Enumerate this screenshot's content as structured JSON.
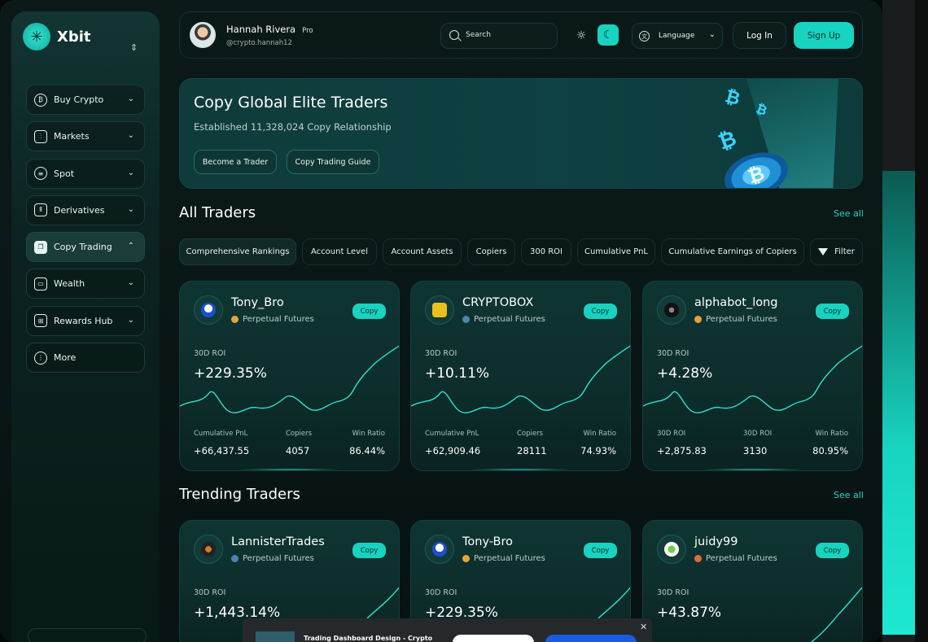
{
  "app": {
    "name": "Xbit"
  },
  "sidebar": {
    "items": [
      {
        "label": "Buy Crypto",
        "icon": "bitcoin-icon",
        "chevron": "⌄"
      },
      {
        "label": "Markets",
        "icon": "candles-icon",
        "chevron": "⌄"
      },
      {
        "label": "Spot",
        "icon": "spot-icon",
        "chevron": "⌄"
      },
      {
        "label": "Derivatives",
        "icon": "derivatives-icon",
        "chevron": "⌄"
      },
      {
        "label": "Copy Trading",
        "icon": "copy-icon",
        "chevron": "⌃",
        "active": true
      },
      {
        "label": "Wealth",
        "icon": "wallet-icon",
        "chevron": "⌄"
      },
      {
        "label": "Rewards Hub",
        "icon": "gift-icon",
        "chevron": "⌄"
      },
      {
        "label": "More",
        "icon": "more-icon",
        "chevron": ""
      }
    ]
  },
  "header": {
    "user_name": "Hannah Rivera",
    "user_tier": "Pro",
    "user_handle": "@crypto.hannah12",
    "search_placeholder": "Search",
    "language_label": "Language",
    "login_label": "Log In",
    "signup_label": "Sign Up"
  },
  "banner": {
    "title": "Copy Global Elite Traders",
    "subtitle": "Established 11,328,024 Copy Relationship",
    "btn_trader": "Become a Trader",
    "btn_guide": "Copy Trading Guide"
  },
  "all_traders": {
    "title": "All Traders",
    "see_all": "See all",
    "tabs": [
      "Comprehensive Rankings",
      "Account Level",
      "Account Assets",
      "Copiers",
      "300 ROI",
      "Cumulative PnL",
      "Cumulative Earnings of Copiers"
    ],
    "filter_label": "Filter",
    "cards": [
      {
        "name": "Tony_Bro",
        "market": "Perpetual Futures",
        "copy": "Copy",
        "roi_label": "30D ROI",
        "roi": "+229.35%",
        "stats": [
          {
            "label": "Cumulative PnL",
            "value": "+66,437.55"
          },
          {
            "label": "Copiers",
            "value": "4057"
          },
          {
            "label": "Win Ratio",
            "value": "86.44%"
          }
        ]
      },
      {
        "name": "CRYPTOBOX",
        "market": "Perpetual Futures",
        "copy": "Copy",
        "roi_label": "30D ROI",
        "roi": "+10.11%",
        "stats": [
          {
            "label": "Cumulative PnL",
            "value": "+62,909.46"
          },
          {
            "label": "Copiers",
            "value": "28111"
          },
          {
            "label": "Win Ratio",
            "value": "74.93%"
          }
        ]
      },
      {
        "name": "alphabot_long",
        "market": "Perpetual Futures",
        "copy": "Copy",
        "roi_label": "30D ROI",
        "roi": "+4.28%",
        "stats": [
          {
            "label": "30D ROI",
            "value": "+2,875.83"
          },
          {
            "label": "30D ROI",
            "value": "3130"
          },
          {
            "label": "Win Ratio",
            "value": "80.95%"
          }
        ]
      }
    ]
  },
  "trending": {
    "title": "Trending Traders",
    "see_all": "See all",
    "cards": [
      {
        "name": "LannisterTrades",
        "market": "Perpetual Futures",
        "copy": "Copy",
        "roi_label": "30D ROI",
        "roi": "+1,443.14%"
      },
      {
        "name": "Tony-Bro",
        "market": "Perpetual Futures",
        "copy": "Copy",
        "roi_label": "30D ROI",
        "roi": "+229.35%"
      },
      {
        "name": "juidy99",
        "market": "Perpetual Futures",
        "copy": "Copy",
        "roi_label": "30D ROI",
        "roi": "+43.87%"
      }
    ]
  },
  "popup": {
    "title": "Trading Dashboard Design - Crypto"
  },
  "colors": {
    "accent": "#17d3c0",
    "background": "#071312"
  }
}
